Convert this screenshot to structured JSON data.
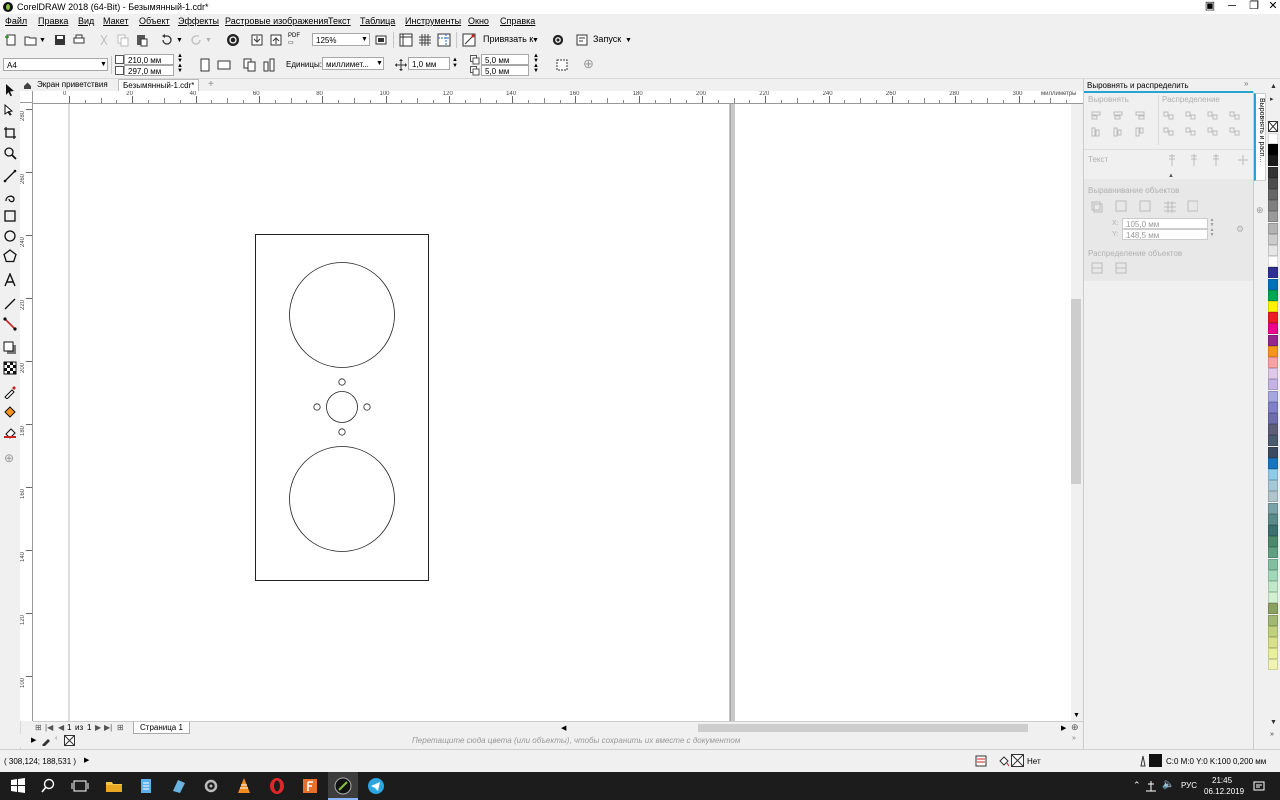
{
  "window": {
    "title": "CorelDRAW 2018 (64-Bit) - Безымянный-1.cdr*"
  },
  "menu": [
    "Файл",
    "Правка",
    "Вид",
    "Макет",
    "Объект",
    "Эффекты",
    "Растровые изображения",
    "Текст",
    "Таблица",
    "Инструменты",
    "Окно",
    "Справка"
  ],
  "toolbar": {
    "zoom": "125%",
    "snap_label": "Привязать к",
    "launch_label": "Запуск",
    "page_size": "A4",
    "width": "210,0 мм",
    "height": "297,0 мм",
    "units_label": "Единицы:",
    "units_value": "миллимет...",
    "nudge": "1,0 мм",
    "dup_x": "5,0 мм",
    "dup_y": "5,0 мм",
    "dpi_label": "DPI"
  },
  "tabs": {
    "welcome": "Экран приветствия",
    "document": "Безымянный-1.cdr*"
  },
  "ruler": {
    "h_ticks": [
      "0",
      "20",
      "40",
      "60",
      "80",
      "100",
      "120",
      "140",
      "160",
      "180",
      "200",
      "220",
      "240",
      "260",
      "280",
      "300"
    ],
    "units": "миллиметры",
    "v_ticks": [
      "280",
      "260",
      "240",
      "220",
      "200",
      "180",
      "160",
      "140",
      "120",
      "100"
    ]
  },
  "pagenav": {
    "current": "1",
    "of": "из",
    "total": "1",
    "page_tab": "Страница 1"
  },
  "colorbar": {
    "hint": "Перетащите сюда цвета (или объекты), чтобы сохранить их вместе с документом"
  },
  "docker": {
    "title": "Выровнять и распределить",
    "align_label": "Выровнять",
    "distribute_label": "Распределение",
    "text_label": "Текст",
    "align_objects_label": "Выравнивание объектов",
    "x_label": "X:",
    "x_value": "105,0 мм",
    "y_label": "Y:",
    "y_value": "148,5 мм",
    "distribute_objects_label": "Распределение объектов",
    "tab_label": "Выровнять и расп..."
  },
  "palette": [
    "#ffffff",
    "#000000",
    "#1a1a1a",
    "#333333",
    "#4d4d4d",
    "#666666",
    "#808080",
    "#999999",
    "#b3b3b3",
    "#cccccc",
    "#e6e6e6",
    "#ffffff",
    "#2e3192",
    "#0072bc",
    "#00a651",
    "#fff200",
    "#ed1c24",
    "#ec008c",
    "#92278f",
    "#f7941d",
    "#f5a3a3",
    "#e0c8e8",
    "#c5b3e6",
    "#a5a5e0",
    "#8080c8",
    "#6d6dad",
    "#5d5d7a",
    "#4a5a70",
    "#3a4a60",
    "#1b75bc",
    "#8fcbe8",
    "#a4c8d8",
    "#b0c4cc",
    "#7aa0a8",
    "#5a8a8a",
    "#3a7070",
    "#4a8a6a",
    "#60a080",
    "#80c0a0",
    "#a0d8b8",
    "#c0e8c8",
    "#d0f0d0",
    "#8aa060",
    "#a0b870",
    "#c0d080",
    "#d8e090",
    "#e8f0a0",
    "#f0f4b0"
  ],
  "status": {
    "coords": "( 308,124; 188,531 )",
    "fill_none": "Нет",
    "outline": "C:0 M:0 Y:0 K:100  0,200 мм"
  },
  "taskbar": {
    "lang": "РУС",
    "time": "21:45",
    "date": "06.12.2019"
  }
}
